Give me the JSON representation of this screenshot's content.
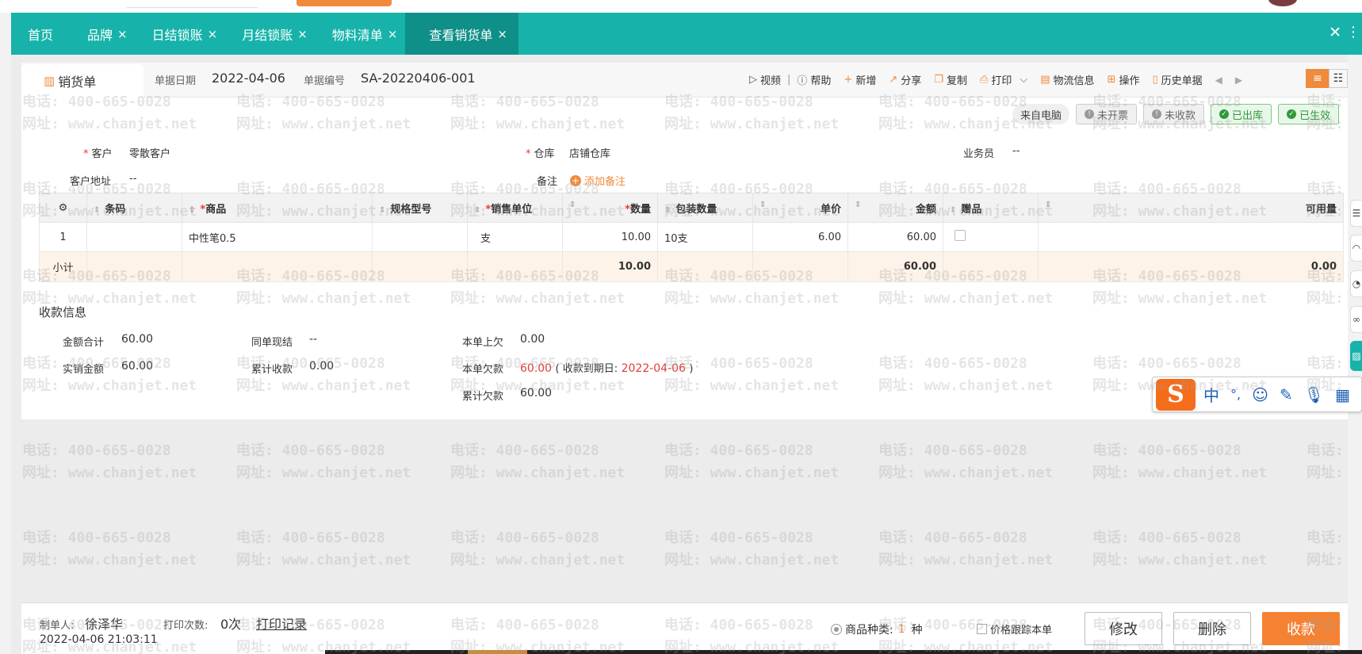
{
  "tabs": [
    {
      "label": "首页",
      "closable": false,
      "active": false
    },
    {
      "label": "品牌",
      "closable": true,
      "active": false
    },
    {
      "label": "日结锁账",
      "closable": true,
      "active": false
    },
    {
      "label": "月结锁账",
      "closable": true,
      "active": false
    },
    {
      "label": "物料清单",
      "closable": true,
      "active": false
    },
    {
      "label": "查看销货单",
      "closable": true,
      "active": true
    }
  ],
  "header": {
    "doc_type": "销货单",
    "date_label": "单据日期",
    "date_value": "2022-04-06",
    "number_label": "单据编号",
    "number_value": "SA-20220406-001"
  },
  "toolbar": {
    "video": "视频",
    "help": "帮助",
    "add": "新增",
    "share": "分享",
    "copy": "复制",
    "print": "打印",
    "logistics": "物流信息",
    "operate": "操作",
    "history": "历史单据"
  },
  "status": {
    "source": "来自电脑",
    "invoice": "未开票",
    "payment": "未收款",
    "outbound": "已出库",
    "effective": "已生效"
  },
  "form": {
    "customer_label": "客户",
    "customer_value": "零散客户",
    "warehouse_label": "仓库",
    "warehouse_value": "店铺仓库",
    "salesman_label": "业务员",
    "salesman_value": "--",
    "address_label": "客户地址",
    "address_value": "--",
    "remark_label": "备注",
    "remark_add": "添加备注"
  },
  "table": {
    "columns": {
      "barcode": "条码",
      "product": "商品",
      "spec": "规格型号",
      "unit": "销售单位",
      "qty": "数量",
      "pack_qty": "包装数量",
      "price": "单价",
      "amount": "金额",
      "gift": "赠品",
      "available": "可用量"
    },
    "rows": [
      {
        "no": "1",
        "barcode": "",
        "product": "中性笔0.5",
        "spec": "",
        "unit": "支",
        "qty": "10.00",
        "pack_qty": "10支",
        "price": "6.00",
        "amount": "60.00",
        "available": ""
      }
    ],
    "subtotal": {
      "label": "小计",
      "qty": "10.00",
      "amount": "60.00",
      "available": "0.00"
    }
  },
  "payment": {
    "title": "收款信息",
    "total_label": "金额合计",
    "total_value": "60.00",
    "same_bill_label": "同单现结",
    "same_bill_value": "--",
    "prev_owed_label": "本单上欠",
    "prev_owed_value": "0.00",
    "actual_label": "实销金额",
    "actual_value": "60.00",
    "cumulative_received_label": "累计收款",
    "cumulative_received_value": "0.00",
    "owed_label": "本单欠款",
    "owed_value": "60.00",
    "due_prefix": "( 收款到期日:",
    "due_date": "2022-04-06",
    "due_suffix": ")",
    "cumulative_owed_label": "累计欠款",
    "cumulative_owed_value": "60.00"
  },
  "ime": {
    "logo": "S",
    "lang": "中",
    "punct": "°,"
  },
  "footer": {
    "maker_label": "制单人:",
    "maker_value": "徐泽华",
    "print_count_label": "打印次数:",
    "print_count_value": "0次",
    "print_record": "打印记录",
    "timestamp": "2022-04-06 21:03:11",
    "kinds_label": "商品种类:",
    "kinds_value": "1",
    "kinds_unit": "种",
    "price_track": "价格跟踪本单",
    "edit": "修改",
    "delete": "删除",
    "collect": "收款"
  },
  "watermark": {
    "line1": "电话: 400-665-0028",
    "line2": "网址: www.chanjet.net"
  },
  "colors": {
    "tabbar": "#17b3aa",
    "tab_active": "#0e8f88",
    "accent": "#f08a3c",
    "danger": "#e23c3c",
    "success": "#2f9a3a"
  }
}
